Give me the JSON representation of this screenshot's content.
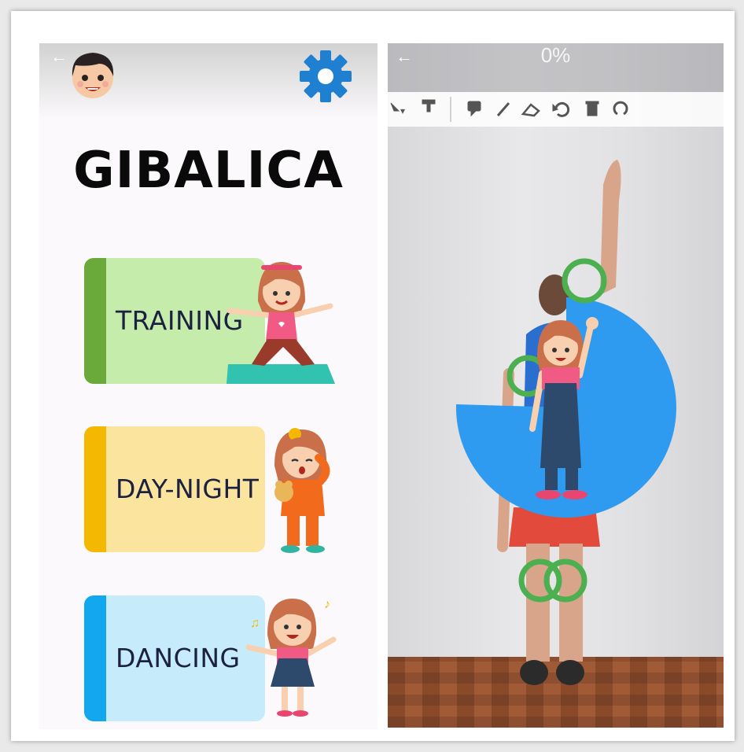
{
  "left_screen": {
    "back_icon": "arrow-left-icon",
    "avatar_icon": "boy-avatar-icon",
    "settings_icon": "gear-icon",
    "title": "GIBALICA",
    "menu": [
      {
        "label": "TRAINING",
        "stripe": "#6aaa3a",
        "bg": "#c5ecaa",
        "icon": "girl-yoga-icon"
      },
      {
        "label": "DAY-NIGHT",
        "stripe": "#f5b800",
        "bg": "#fbe59e",
        "icon": "sleepy-girl-icon"
      },
      {
        "label": "DANCING",
        "stripe": "#12a8ef",
        "bg": "#c6ecfb",
        "icon": "dancing-girl-icon"
      }
    ],
    "accent": "#1f7fd1"
  },
  "right_screen": {
    "back_icon": "arrow-left-icon",
    "progress_text": "0%",
    "progress_fraction": 0.0,
    "toolbar_icons": [
      "pointer-icon",
      "stamp-icon",
      "comment-icon",
      "pen-icon",
      "eraser-icon",
      "undo-icon",
      "trash-icon",
      "redo-icon"
    ],
    "progress_arc_color": "#2f9bf0",
    "pose_marker_color": "#4caf50"
  }
}
